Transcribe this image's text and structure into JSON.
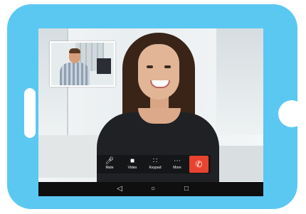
{
  "call_controls": {
    "mute_label": "Mute",
    "video_label": "Video",
    "keypad_label": "Keypad",
    "more_label": "More",
    "icons": {
      "mute": "mic-muted-icon",
      "video": "video-off-icon",
      "keypad": "keypad-icon",
      "more": "more-icon",
      "end": "end-call-icon"
    },
    "end_call_color": "#e8432f"
  },
  "nav_bar": {
    "icons": [
      "back-icon",
      "home-icon",
      "recents-icon"
    ]
  },
  "colors": {
    "device_frame": "#5bc8f2",
    "control_bar": "#141416"
  }
}
